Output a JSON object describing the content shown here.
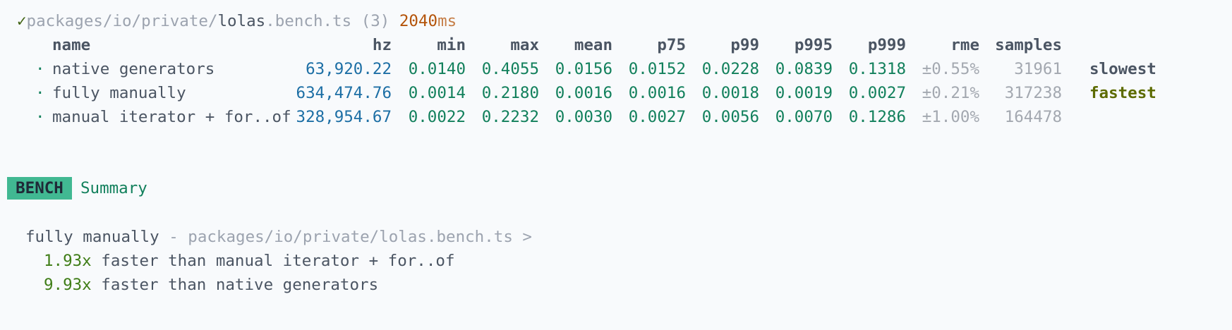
{
  "file_line": {
    "check": "✓",
    "path_prefix": "packages/io/private/",
    "file_name": "lolas",
    "file_ext": ".bench.ts",
    "count": "(3)",
    "duration": "2040",
    "unit": "ms"
  },
  "table": {
    "columns": [
      "name",
      "hz",
      "min",
      "max",
      "mean",
      "p75",
      "p99",
      "p995",
      "p999",
      "rme",
      "samples"
    ],
    "rows": [
      {
        "bullet": "·",
        "name": "native generators",
        "hz": "63,920.22",
        "min": "0.0140",
        "max": "0.4055",
        "mean": "0.0156",
        "p75": "0.0152",
        "p99": "0.0228",
        "p995": "0.0839",
        "p999": "0.1318",
        "rme": "±0.55%",
        "samples": "31961",
        "tag": "slowest"
      },
      {
        "bullet": "·",
        "name": "fully manually",
        "hz": "634,474.76",
        "min": "0.0014",
        "max": "0.2180",
        "mean": "0.0016",
        "p75": "0.0016",
        "p99": "0.0018",
        "p995": "0.0019",
        "p999": "0.0027",
        "rme": "±0.21%",
        "samples": "317238",
        "tag": "fastest"
      },
      {
        "bullet": "·",
        "name": "manual iterator + for..of",
        "hz": "328,954.67",
        "min": "0.0022",
        "max": "0.2232",
        "mean": "0.0030",
        "p75": "0.0027",
        "p99": "0.0056",
        "p995": "0.0070",
        "p999": "0.1286",
        "rme": "±1.00%",
        "samples": "164478",
        "tag": ""
      }
    ]
  },
  "summary": {
    "badge": "BENCH",
    "title": "Summary",
    "winner": "fully manually",
    "separator": " - ",
    "winner_path": "packages/io/private/lolas.bench.ts >",
    "comparisons": [
      {
        "multiplier": "1.93x",
        "text": " faster than manual iterator + for..of"
      },
      {
        "multiplier": "9.93x",
        "text": " faster than native generators"
      }
    ]
  },
  "colors": {
    "background": "#f8fafc",
    "badge": "#41b892",
    "hz": "#1d6fa5",
    "stats": "#12805c",
    "fastest": "#5c6b00"
  }
}
